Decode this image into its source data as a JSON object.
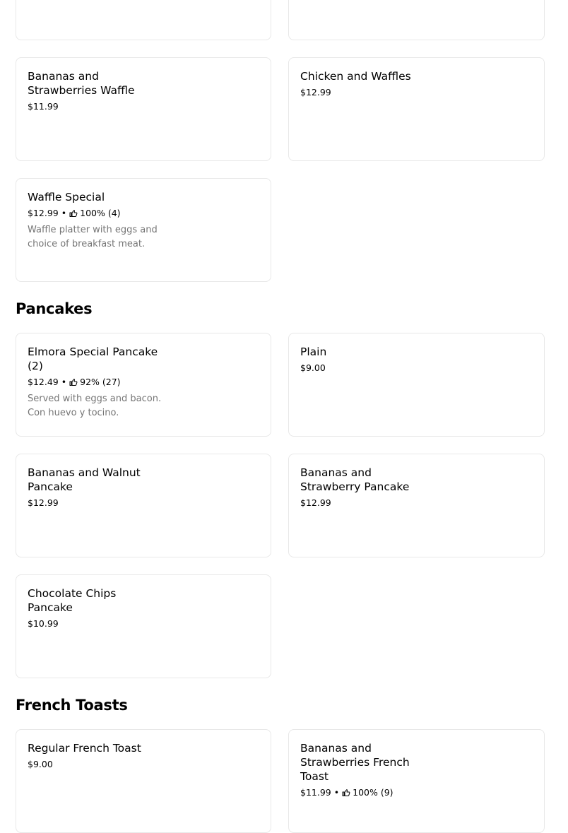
{
  "sections": {
    "pancakes": "Pancakes",
    "french_toasts": "French Toasts"
  },
  "items": {
    "bananas_strawberries_waffle": {
      "name": "Bananas and Strawberries Waffle",
      "price": "$11.99"
    },
    "chicken_and_waffles": {
      "name": "Chicken and Waffles",
      "price": "$12.99"
    },
    "waffle_special": {
      "name": "Waffle Special",
      "price": "$12.99",
      "separator": "•",
      "rating": "100% (4)",
      "description": "Waffle platter with eggs and choice of breakfast meat."
    },
    "elmora_special_pancake": {
      "name": "Elmora Special Pancake (2)",
      "price": "$12.49",
      "separator": "•",
      "rating": "92% (27)",
      "description": "Served with eggs and bacon. Con huevo y tocino."
    },
    "plain": {
      "name": "Plain",
      "price": "$9.00"
    },
    "bananas_walnut_pancake": {
      "name": "Bananas and Walnut Pancake",
      "price": "$12.99"
    },
    "bananas_strawberry_pancake": {
      "name": "Bananas and Strawberry Pancake",
      "price": "$12.99"
    },
    "chocolate_chips_pancake": {
      "name": "Chocolate Chips Pancake",
      "price": "$10.99"
    },
    "regular_french_toast": {
      "name": "Regular French Toast",
      "price": "$9.00"
    },
    "bananas_strawberries_french_toast": {
      "name": "Bananas and Strawberries French Toast",
      "price": "$11.99",
      "separator": "•",
      "rating": "100% (9)"
    }
  },
  "icons": {
    "rating": "thumbs-up-icon"
  },
  "colors": {
    "card_border": "#e8e8e8",
    "description_text": "#757575"
  }
}
